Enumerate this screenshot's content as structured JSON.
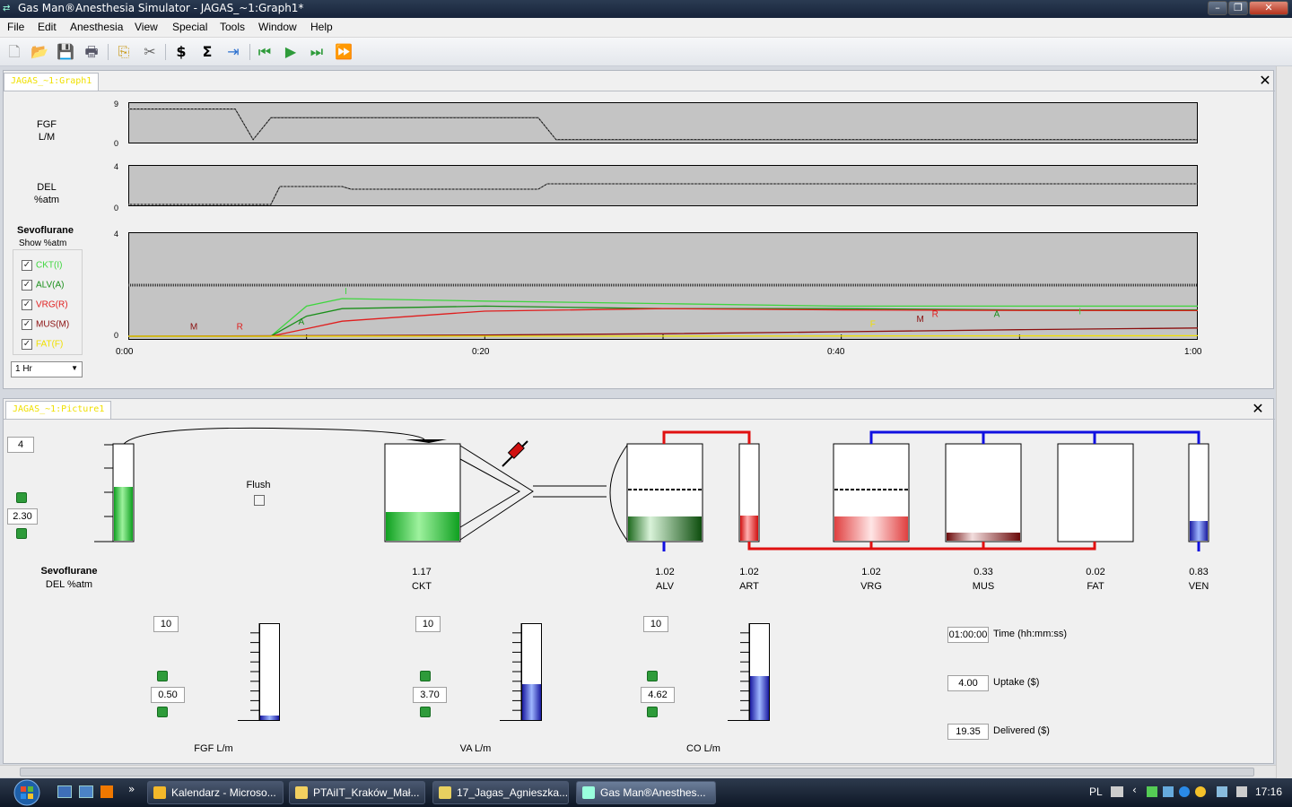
{
  "window": {
    "title": "Gas Man®Anesthesia Simulator - JAGAS_~1:Graph1*"
  },
  "menu": [
    "File",
    "Edit",
    "Anesthesia",
    "View",
    "Special",
    "Tools",
    "Window",
    "Help"
  ],
  "toolbar_icons": [
    "new-icon",
    "open-icon",
    "save-icon",
    "print-icon",
    "copy-icon",
    "cut-icon",
    "dollar-icon",
    "sum-icon",
    "export-icon",
    "rewind-icon",
    "play-icon",
    "step-icon",
    "fast-forward-icon"
  ],
  "graph_panel": {
    "tab": "JAGAS_~1:Graph1",
    "fgf": {
      "label1": "FGF",
      "label2": "L/M",
      "ymax": "9",
      "ymin": "0"
    },
    "del": {
      "label1": "DEL",
      "label2": "%atm",
      "ymax": "4",
      "ymin": "0"
    },
    "main": {
      "agent": "Sevoflurane",
      "show": "Show %atm",
      "ymax": "4",
      "ymin": "0",
      "legend": [
        {
          "label": "CKT(I)",
          "color": "#3ed63e",
          "checked": true
        },
        {
          "label": "ALV(A)",
          "color": "#1a8f1a",
          "checked": true
        },
        {
          "label": "VRG(R)",
          "color": "#e01e1e",
          "checked": true
        },
        {
          "label": "MUS(M)",
          "color": "#8b0f0f",
          "checked": true
        },
        {
          "label": "FAT(F)",
          "color": "#f0e000",
          "checked": true
        }
      ],
      "markers": [
        "M",
        "R",
        "A",
        "I",
        "R",
        "A",
        "I",
        "F",
        "M"
      ],
      "xticks": [
        "0:00",
        "0:20",
        "0:40",
        "1:00"
      ],
      "range": "1 Hr"
    }
  },
  "chart_data": [
    {
      "type": "line",
      "ylabel": "FGF L/M",
      "ylim": [
        0,
        9
      ],
      "x": [
        "0:00",
        "0:06",
        "0:07",
        "0:08",
        "0:23",
        "0:24",
        "1:00"
      ],
      "series": [
        {
          "values": [
            8.2,
            8.2,
            0.5,
            6.0,
            6.0,
            0.5,
            0.5
          ]
        }
      ]
    },
    {
      "type": "line",
      "ylabel": "DEL %atm",
      "ylim": [
        0,
        4
      ],
      "x": [
        "0:00",
        "0:08",
        "0:08.5",
        "0:12",
        "0:12.5",
        "0:23",
        "0:23.5",
        "1:00"
      ],
      "series": [
        {
          "values": [
            0.0,
            0.0,
            2.0,
            2.0,
            1.7,
            1.7,
            2.3,
            2.3
          ]
        }
      ]
    },
    {
      "type": "line",
      "title": "Sevoflurane",
      "ylabel": "%atm",
      "ylim": [
        0,
        4
      ],
      "xticks": [
        "0:00",
        "0:20",
        "0:40",
        "1:00"
      ],
      "series": [
        {
          "name": "CKT(I)",
          "x": [
            0,
            8,
            10,
            12,
            20,
            30,
            40,
            50,
            60
          ],
          "values": [
            0,
            0,
            1.2,
            1.5,
            1.4,
            1.3,
            1.2,
            1.2,
            1.2
          ]
        },
        {
          "name": "ALV(A)",
          "x": [
            0,
            8,
            10,
            12,
            20,
            30,
            40,
            50,
            60
          ],
          "values": [
            0,
            0,
            0.8,
            1.1,
            1.2,
            1.1,
            1.1,
            1.05,
            1.05
          ]
        },
        {
          "name": "VRG(R)",
          "x": [
            0,
            8,
            10,
            12,
            20,
            30,
            40,
            50,
            60
          ],
          "values": [
            0,
            0,
            0.3,
            0.6,
            1.0,
            1.1,
            1.05,
            1.03,
            1.02
          ]
        },
        {
          "name": "MUS(M)",
          "x": [
            0,
            10,
            20,
            30,
            40,
            50,
            60
          ],
          "values": [
            0,
            0.02,
            0.05,
            0.1,
            0.18,
            0.26,
            0.33
          ]
        },
        {
          "name": "FAT(F)",
          "x": [
            0,
            20,
            40,
            60
          ],
          "values": [
            0,
            0.005,
            0.01,
            0.02
          ]
        }
      ]
    }
  ],
  "picture_panel": {
    "tab": "JAGAS_~1:Picture1",
    "del_max": "4",
    "del_value": "2.30",
    "flush_label": "Flush",
    "agent": "Sevoflurane",
    "del_unit": "DEL %atm",
    "compartments": [
      {
        "value": "1.17",
        "name": "CKT"
      },
      {
        "value": "1.02",
        "name": "ALV"
      },
      {
        "value": "1.02",
        "name": "ART"
      },
      {
        "value": "1.02",
        "name": "VRG"
      },
      {
        "value": "0.33",
        "name": "MUS"
      },
      {
        "value": "0.02",
        "name": "FAT"
      },
      {
        "value": "0.83",
        "name": "VEN"
      }
    ],
    "flows": [
      {
        "max": "10",
        "value": "0.50",
        "label": "FGF  L/m",
        "fill": 0.05
      },
      {
        "max": "10",
        "value": "3.70",
        "label": "VA  L/m",
        "fill": 0.37
      },
      {
        "max": "10",
        "value": "4.62",
        "label": "CO  L/m",
        "fill": 0.46
      }
    ],
    "time_value": "01:00:00",
    "time_label": "Time (hh:mm:ss)",
    "uptake_value": "4.00",
    "uptake_label": "Uptake ($)",
    "delivered_value": "19.35",
    "delivered_label": "Delivered ($)"
  },
  "taskbar": {
    "tasks": [
      "Kalendarz - Microso...",
      "PTAiIT_Kraków_Mał...",
      "17_Jagas_Agnieszka...",
      "Gas Man®Anesthes..."
    ],
    "lang": "PL",
    "clock": "17:16"
  }
}
